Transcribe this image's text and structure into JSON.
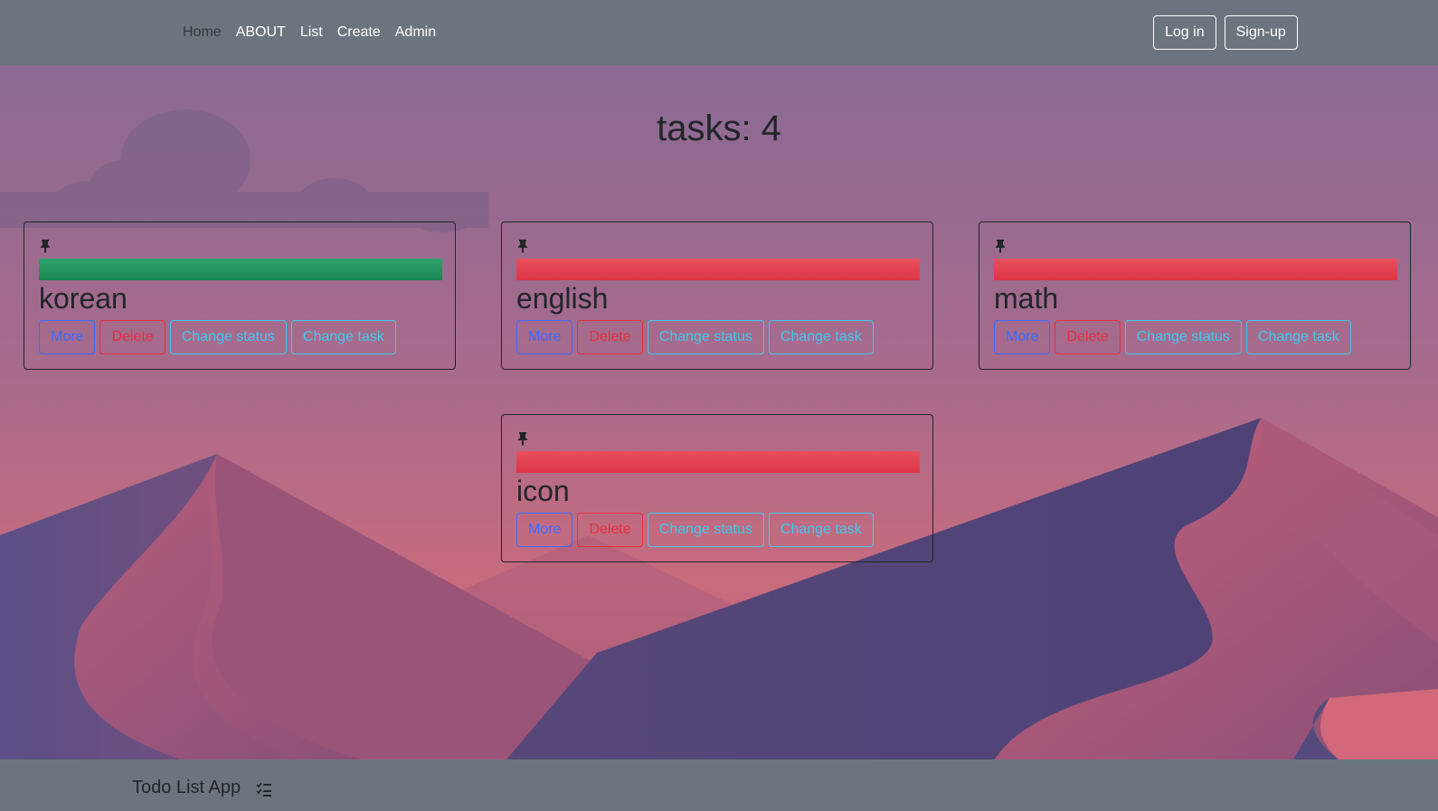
{
  "navbar": {
    "links": [
      "Home",
      "ABOUT",
      "List",
      "Create",
      "Admin"
    ],
    "login_label": "Log in",
    "signup_label": "Sign-up"
  },
  "main": {
    "title": "tasks: 4",
    "tasks": [
      {
        "name": "korean",
        "status": "done",
        "status_color": "#198754"
      },
      {
        "name": "english",
        "status": "todo",
        "status_color": "#dc3545"
      },
      {
        "name": "math",
        "status": "todo",
        "status_color": "#dc3545"
      },
      {
        "name": "icon",
        "status": "todo",
        "status_color": "#dc3545"
      }
    ],
    "buttons": {
      "more": "More",
      "delete": "Delete",
      "change_status": "Change status",
      "change_task": "Change task"
    }
  },
  "footer": {
    "text": "Todo List App",
    "icon": "checklist-icon"
  }
}
